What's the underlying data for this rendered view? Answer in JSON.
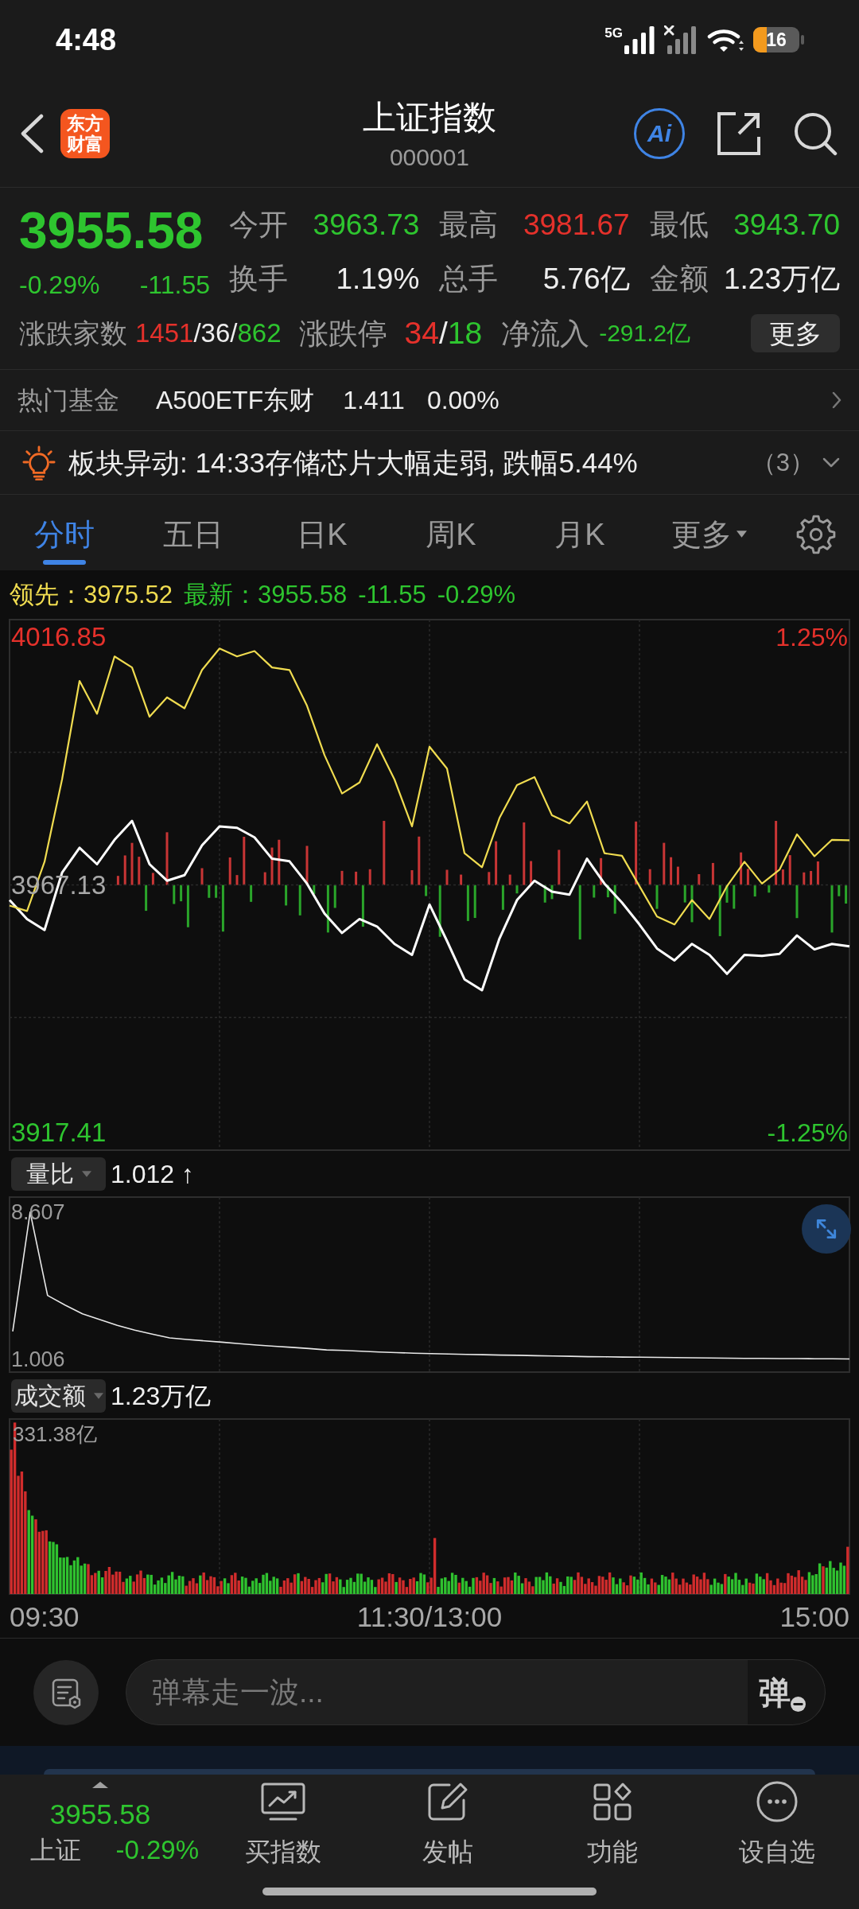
{
  "status_bar": {
    "time": "4:48",
    "network": "5G",
    "battery": "16"
  },
  "header": {
    "logo": "东方财富",
    "title": "上证指数",
    "code": "000001",
    "ai_label": "Ai"
  },
  "quote": {
    "price": "3955.58",
    "color": "#2ec52f",
    "change_percent": "-0.29%",
    "change": "-11.55",
    "stats": [
      {
        "label": "今开",
        "value": "3963.73",
        "color": "#2ec52f"
      },
      {
        "label": "最高",
        "value": "3981.67",
        "color": "#e5312b"
      },
      {
        "label": "最低",
        "value": "3943.70",
        "color": "#2ec52f"
      },
      {
        "label": "换手",
        "value": "1.19%",
        "color": "#eeeeee"
      },
      {
        "label": "总手",
        "value": "5.76亿",
        "color": "#eeeeee"
      },
      {
        "label": "金额",
        "value": "1.23万亿",
        "color": "#eeeeee"
      }
    ],
    "breadth": {
      "label": "涨跌家数",
      "parts": [
        {
          "text": "1451",
          "color": "#e5312b"
        },
        {
          "text": "/",
          "color": "#eeeeee"
        },
        {
          "text": "36",
          "color": "#eeeeee"
        },
        {
          "text": "/",
          "color": "#eeeeee"
        },
        {
          "text": "862",
          "color": "#2ec52f"
        }
      ]
    },
    "limits": {
      "label": "涨跌停",
      "parts": [
        {
          "text": "34",
          "color": "#e5312b"
        },
        {
          "text": "/",
          "color": "#eeeeee"
        },
        {
          "text": "18",
          "color": "#2ec52f"
        }
      ]
    },
    "net_inflow": {
      "label": "净流入",
      "value": "-291.2亿",
      "color": "#2ec52f"
    },
    "more_button": "更多"
  },
  "hot_fund": {
    "label": "热门基金",
    "name": "A500ETF东财",
    "price": "1.411",
    "change": "0.00%"
  },
  "alert": {
    "text": "板块异动: 14:33存储芯片大幅走弱, 跌幅5.44%",
    "count": "（3）"
  },
  "tabs": [
    {
      "label": "分时",
      "selected": true,
      "kind": "view"
    },
    {
      "label": "五日",
      "selected": false,
      "kind": "view"
    },
    {
      "label": "日K",
      "selected": false,
      "kind": "view"
    },
    {
      "label": "周K",
      "selected": false,
      "kind": "view"
    },
    {
      "label": "月K",
      "selected": false,
      "kind": "view"
    },
    {
      "label": "更多",
      "selected": false,
      "kind": "menu"
    }
  ],
  "legend": [
    {
      "text": "领先：3975.52",
      "color": "#f0dc50"
    },
    {
      "text": "最新：3955.58",
      "color": "#2ec52f"
    },
    {
      "text": "-11.55",
      "color": "#2ec52f"
    },
    {
      "text": "-0.29%",
      "color": "#2ec52f"
    }
  ],
  "main_chart": {
    "percent_labels": [
      {
        "label": "1.25%",
        "color": "#e5312b"
      },
      {
        "label": "-1.25%",
        "color": "#2ec52f"
      }
    ],
    "chart_data": {
      "type": "line",
      "categories": [
        null,
        null,
        null,
        null,
        null,
        null,
        null,
        null,
        null,
        null,
        null,
        null,
        null,
        null,
        null,
        null,
        null,
        null,
        null,
        null,
        null,
        null,
        null,
        null,
        null,
        null,
        null,
        null,
        null,
        null,
        null,
        null,
        null,
        null,
        null,
        null,
        null,
        null,
        null,
        null,
        null,
        null,
        null,
        null,
        null,
        null,
        null,
        null,
        null
      ],
      "series": [
        {
          "color": "#ffffff",
          "values": [
            3964.1,
            3960.3,
            3958.1,
            3969.6,
            3974.6,
            3971.3,
            3976.2,
            3980.0,
            3971.3,
            3968.0,
            3969.1,
            3975.1,
            3978.9,
            3978.6,
            3976.7,
            3972.4,
            3971.9,
            3967.4,
            3961.4,
            3957.5,
            3960.3,
            3958.8,
            3955.3,
            3953.1,
            3963.2,
            3955.9,
            3948.2,
            3946.0,
            3956.4,
            3964.1,
            3968.0,
            3965.8,
            3965.2,
            3972.4,
            3967.4,
            3963.6,
            3959.2,
            3954.4,
            3952.0,
            3955.3,
            3953.1,
            3949.3,
            3953.1,
            3952.9,
            3953.3,
            3957.0,
            3954.2,
            3955.3,
            3954.8
          ]
        },
        {
          "color": "#f0dc50",
          "values": [
            3963.0,
            3961.9,
            3971.8,
            3988.3,
            4008.1,
            4001.5,
            4013.0,
            4010.8,
            4000.9,
            4004.8,
            4002.6,
            4010.3,
            4014.6,
            4013.0,
            4014.1,
            4010.8,
            4010.3,
            4003.1,
            3993.2,
            3985.5,
            3987.7,
            3995.4,
            3988.3,
            3978.9,
            3994.9,
            3990.5,
            3973.5,
            3970.7,
            3980.6,
            3987.2,
            3988.8,
            3981.1,
            3979.5,
            3983.9,
            3973.5,
            3973.0,
            3966.9,
            3960.8,
            3959.2,
            3964.1,
            3960.3,
            3966.9,
            3971.8,
            3967.4,
            3970.2,
            3977.3,
            3972.9,
            3976.2,
            3976.1
          ]
        }
      ],
      "ylim": [
        3913.9,
        4020.4
      ],
      "yticks": [
        {
          "value": 4016.85,
          "label": "4016.85"
        },
        {
          "value": 3967.13,
          "label": "3967.13"
        },
        {
          "value": 3917.41,
          "label": "3917.41"
        }
      ],
      "grid": true
    }
  },
  "volume_ratio": {
    "label": "量比",
    "value": "1.012 ↑",
    "chart_data": {
      "type": "line",
      "categories": [
        null,
        null,
        null,
        null,
        null,
        null,
        null,
        null,
        null,
        null,
        null,
        null,
        null,
        null,
        null,
        null,
        null,
        null,
        null,
        null,
        null,
        null,
        null,
        null,
        null,
        null,
        null,
        null,
        null,
        null,
        null,
        null,
        null,
        null,
        null,
        null,
        null,
        null,
        null,
        null,
        null,
        null,
        null,
        null,
        null,
        null,
        null,
        null,
        null
      ],
      "series": [
        {
          "color": "#e8e8e8",
          "values": [
            2.44,
            8.61,
            4.3,
            3.8,
            3.35,
            3.05,
            2.75,
            2.5,
            2.3,
            2.1,
            2.02,
            1.95,
            1.88,
            1.8,
            1.73,
            1.67,
            1.61,
            1.55,
            1.48,
            1.45,
            1.41,
            1.37,
            1.34,
            1.31,
            1.29,
            1.27,
            1.25,
            1.23,
            1.21,
            1.2,
            1.18,
            1.16,
            1.15,
            1.13,
            1.12,
            1.11,
            1.1,
            1.09,
            1.08,
            1.07,
            1.06,
            1.05,
            1.04,
            1.04,
            1.03,
            1.03,
            1.02,
            1.02,
            1.01
          ]
        }
      ],
      "ylim": [
        0.33,
        9.39
      ],
      "yticks": [
        {
          "value": 8.607,
          "label": "8.607"
        },
        {
          "value": 1.006,
          "label": "1.006"
        }
      ],
      "grid": true
    }
  },
  "turnover": {
    "label": "成交额",
    "value": "1.23万亿",
    "max_label": "331.38亿"
  },
  "time_axis": [
    "09:30",
    "11:30/13:00",
    "15:00"
  ],
  "danmaku": {
    "placeholder": "弹幕走一波...",
    "send_button": "弹"
  },
  "bottom_nav": {
    "index": {
      "price": "3955.58",
      "name": "上证",
      "change": "-0.29%",
      "color": "#2ec52f"
    },
    "items": [
      {
        "label": "买指数",
        "kind": "trade"
      },
      {
        "label": "发帖",
        "kind": "post"
      },
      {
        "label": "功能",
        "kind": "tools"
      },
      {
        "label": "设自选",
        "kind": "watchlist"
      }
    ]
  }
}
